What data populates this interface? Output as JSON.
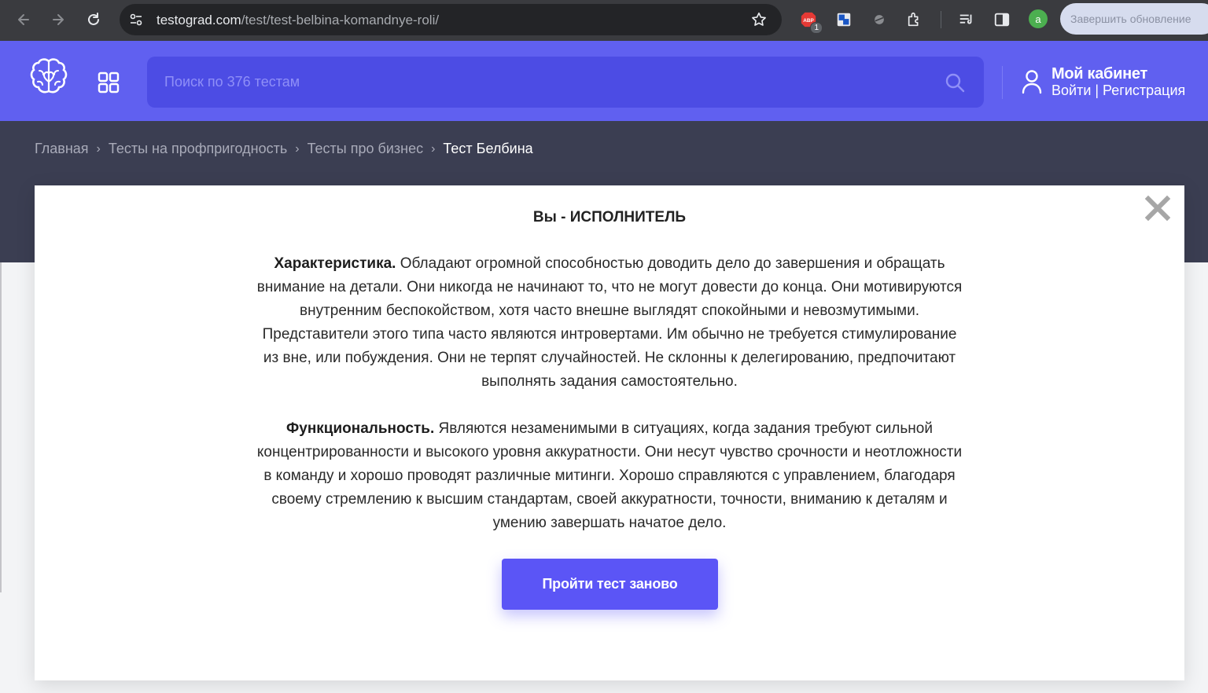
{
  "browser": {
    "url_domain": "testograd.com",
    "url_path": "/test/test-belbina-komandnye-roli/",
    "profile_initial": "a",
    "extension_badge": "1",
    "update_label": "Завершить обновление"
  },
  "header": {
    "search_placeholder": "Поиск по 376 тестам",
    "cabinet_title": "Мой кабинет",
    "cabinet_links": "Войти | Регистрация"
  },
  "breadcrumb": {
    "items": [
      "Главная",
      "Тесты на профпригодность",
      "Тесты про бизнес",
      "Тест Белбина"
    ],
    "separator": "›"
  },
  "modal": {
    "title": "Вы - ИСПОЛНИТЕЛЬ",
    "p1_label": "Характеристика.",
    "p1_text": " Обладают огромной способностью доводить дело до завершения и обращать внимание на детали. Они никогда не начинают то, что не могут довести до конца. Они мотивируются внутренним беспокойством, хотя часто внешне выглядят спокойными и невозмутимыми. Представители этого типа часто являются интровертами. Им обычно не требуется стимулирование из вне, или побуждения. Они не терпят случайностей. Не склонны к делегированию, предпочитают выполнять задания самостоятельно.",
    "p2_label": "Функциональность.",
    "p2_text": " Являются незаменимыми в ситуациях, когда задания требуют сильной концентрированности и высокого уровня аккуратности. Они несут чувство срочности и неотложности в команду и хорошо проводят различные митинги. Хорошо справляются с управлением, благодаря своему стремлению к высшим стандартам, своей аккуратности, точности, вниманию к деталям и умению завершать начатое дело.",
    "retry_button": "Пройти тест заново"
  },
  "colors": {
    "brand": "#6060f0",
    "brand_dark": "#4c4ce4",
    "band": "#3b3e52",
    "button": "#5b55f6"
  },
  "icons": [
    "back-arrow-icon",
    "forward-arrow-icon",
    "reload-icon",
    "site-settings-icon",
    "bookmark-star-icon",
    "extension-icon",
    "reading-list-icon",
    "side-panel-icon",
    "brain-logo-icon",
    "grid-icon",
    "search-icon",
    "user-icon",
    "close-icon"
  ]
}
